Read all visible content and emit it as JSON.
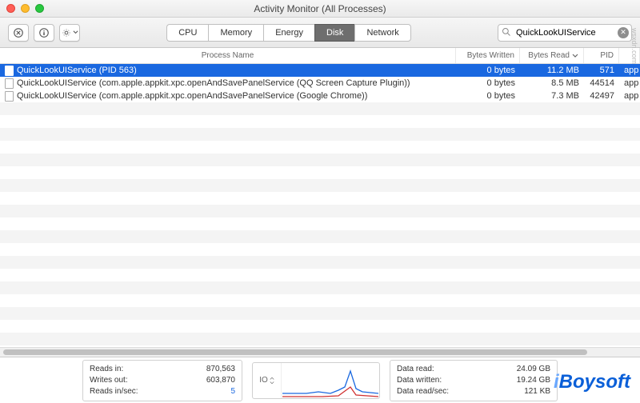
{
  "window": {
    "title": "Activity Monitor (All Processes)"
  },
  "toolbar": {
    "tabs": [
      "CPU",
      "Memory",
      "Energy",
      "Disk",
      "Network"
    ],
    "active_tab_index": 3,
    "search": {
      "placeholder": "Search",
      "value": "QuickLookUIService"
    }
  },
  "columns": {
    "name": "Process Name",
    "bytes_written": "Bytes Written",
    "bytes_read": "Bytes Read",
    "pid": "PID"
  },
  "rows": [
    {
      "name": "QuickLookUIService (PID 563)",
      "bytes_written": "0 bytes",
      "bytes_read": "11.2 MB",
      "pid": "571",
      "user": "app",
      "selected": true
    },
    {
      "name": "QuickLookUIService (com.apple.appkit.xpc.openAndSavePanelService (QQ Screen Capture Plugin))",
      "bytes_written": "0 bytes",
      "bytes_read": "8.5 MB",
      "pid": "44514",
      "user": "app",
      "selected": false
    },
    {
      "name": "QuickLookUIService (com.apple.appkit.xpc.openAndSavePanelService (Google Chrome))",
      "bytes_written": "0 bytes",
      "bytes_read": "7.3 MB",
      "pid": "42497",
      "user": "app",
      "selected": false
    }
  ],
  "footer": {
    "left": {
      "reads_in_label": "Reads in:",
      "reads_in_value": "870,563",
      "writes_out_label": "Writes out:",
      "writes_out_value": "603,870",
      "reads_sec_label": "Reads in/sec:",
      "reads_sec_value": "5"
    },
    "graph_label": "IO",
    "right": {
      "data_read_label": "Data read:",
      "data_read_value": "24.09 GB",
      "data_written_label": "Data written:",
      "data_written_value": "19.24 GB",
      "data_read_sec_label": "Data read/sec:",
      "data_read_sec_value": "121 KB"
    }
  },
  "watermark": {
    "brand": "iBoysoft",
    "site": "wsxdn.com"
  }
}
